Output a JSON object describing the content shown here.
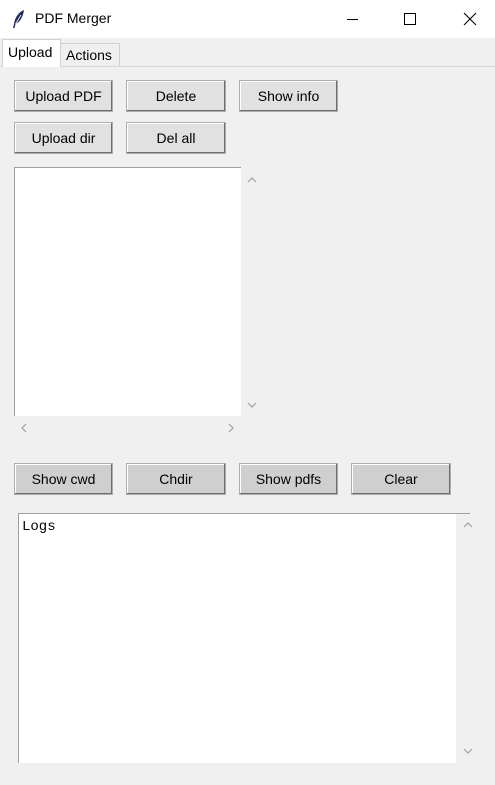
{
  "window": {
    "title": "PDF Merger",
    "icon": "feather-icon"
  },
  "tabs": [
    {
      "label": "Upload",
      "active": true
    },
    {
      "label": "Actions",
      "active": false
    }
  ],
  "upload_buttons": {
    "upload_pdf": "Upload PDF",
    "delete": "Delete",
    "show_info": "Show info",
    "upload_dir": "Upload dir",
    "del_all": "Del all"
  },
  "file_list": {
    "items": []
  },
  "action_buttons": {
    "show_cwd": "Show cwd",
    "chdir": "Chdir",
    "show_pdfs": "Show pdfs",
    "clear": "Clear"
  },
  "logs": {
    "text": "Logs"
  },
  "colors": {
    "window_bg": "#f0f0f0",
    "titlebar_bg": "#ffffff",
    "button_bg": "#e1e1e1",
    "button_gray_bg": "#cfcfcf"
  }
}
